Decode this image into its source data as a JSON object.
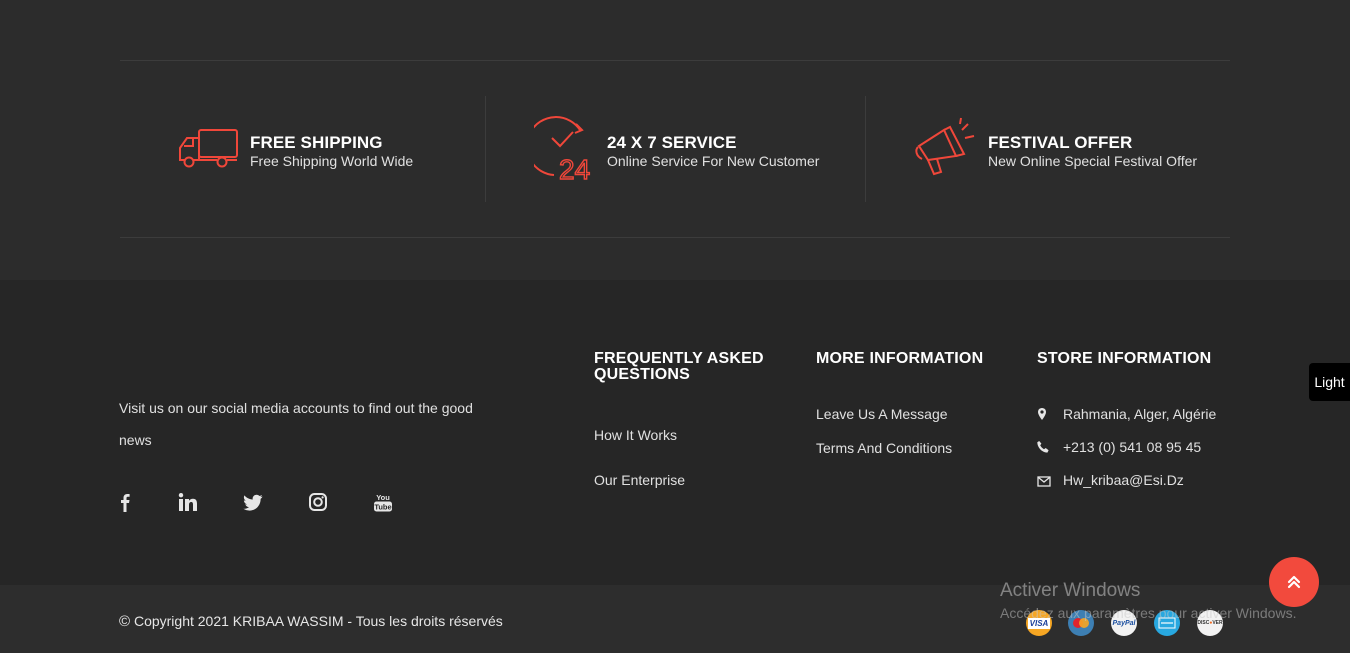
{
  "colors": {
    "accent": "#f0473a",
    "background": "#2a2a2a",
    "footer_bg": "#262626"
  },
  "features": [
    {
      "icon": "delivery-truck-icon",
      "title": "FREE SHIPPING",
      "subtitle": "Free Shipping World Wide"
    },
    {
      "icon": "clock-24-icon",
      "title": "24 X 7 SERVICE",
      "subtitle": "Online Service For New Customer"
    },
    {
      "icon": "megaphone-icon",
      "title": "FESTIVAL OFFER",
      "subtitle": "New Online Special Festival Offer"
    }
  ],
  "about": {
    "text": "Visit us on our social media accounts to find out the good news",
    "social": [
      "facebook-icon",
      "linkedin-icon",
      "twitter-icon",
      "instagram-icon",
      "youtube-icon"
    ]
  },
  "faq": {
    "title": "FREQUENTLY ASKED QUESTIONS",
    "links": [
      "How It Works",
      "Our Enterprise"
    ]
  },
  "more_info": {
    "title": "MORE INFORMATION",
    "links": [
      "Leave Us A Message",
      "Terms And Conditions"
    ]
  },
  "store_info": {
    "title": "STORE INFORMATION",
    "address": "Rahmania, Alger, Algérie",
    "phone": "+213 (0) 541 08 95 45",
    "email": "Hw_kribaa@Esi.Dz"
  },
  "copyright": "Copyright 2021 KRIBAA WASSIM - Tous les droits réservés",
  "payment_cards": [
    "VISA",
    "MasterCard",
    "PayPal",
    "American Express",
    "DISCOVER"
  ],
  "theme_toggle": "Light",
  "watermark": {
    "title": "Activer Windows",
    "subtitle": "Accédez aux paramètres pour activer Windows."
  }
}
